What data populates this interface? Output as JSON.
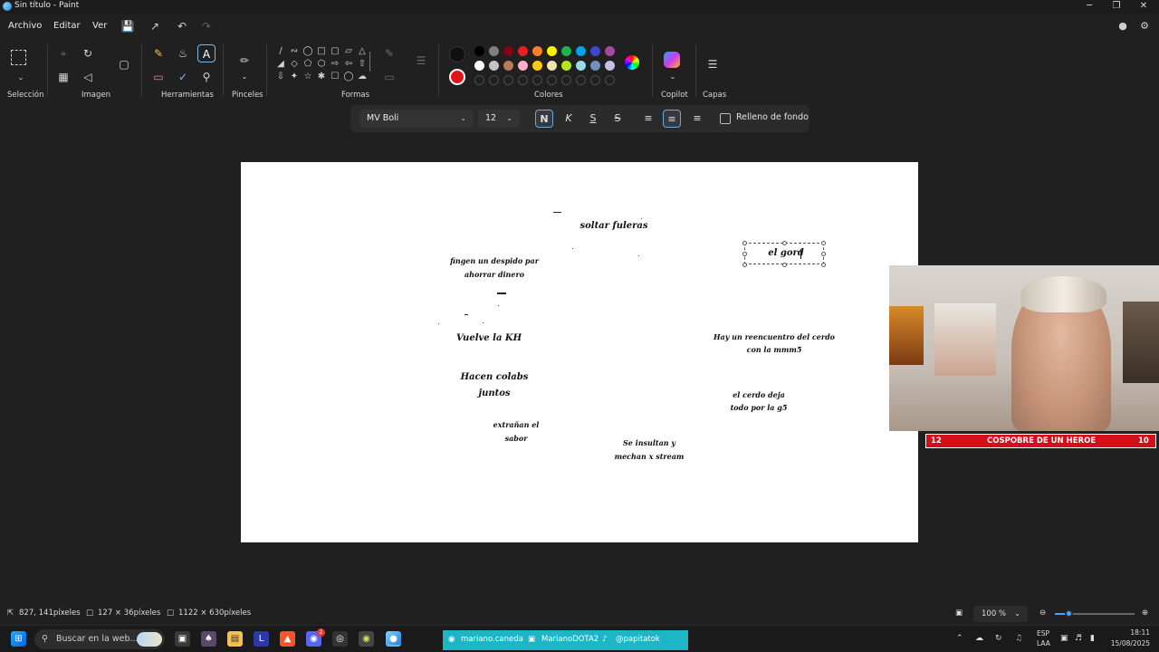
{
  "window": {
    "title": "Sin título - Paint",
    "minimize": "─",
    "maximize": "❐",
    "close": "✕"
  },
  "menu": {
    "items": [
      "Archivo",
      "Editar",
      "Ver"
    ]
  },
  "ribbon": {
    "groups": {
      "seleccion": "Selección",
      "imagen": "Imagen",
      "herramientas": "Herramientas",
      "pinceles": "Pinceles",
      "formas": "Formas",
      "colores": "Colores",
      "copilot": "Copilot",
      "capas": "Capas"
    },
    "colors": {
      "primary": "#111111",
      "secondary": "#e5121c",
      "row1": [
        "#000000",
        "#7f7f7f",
        "#880015",
        "#ed1c24",
        "#ff7f27",
        "#fff200",
        "#22b14c",
        "#00a2e8",
        "#3f48cc",
        "#a349a4"
      ],
      "row2": [
        "#ffffff",
        "#c3c3c3",
        "#b97a57",
        "#ffaec9",
        "#ffc90e",
        "#efe4b0",
        "#b5e61d",
        "#99d9ea",
        "#7092be",
        "#c8bfe7"
      ]
    }
  },
  "text_toolbar": {
    "font": "MV Boli",
    "size": "12",
    "bold": "N",
    "italic": "K",
    "underline": "S",
    "strikethrough": "S",
    "fill_label": "Relleno de fondo"
  },
  "canvas": {
    "texts": {
      "soltar": "soltar fuleras",
      "fingen1": "fingen un despido par",
      "fingen2": "ahorrar dinero",
      "vuelve": "Vuelve la KH",
      "hacen1": "Hacen colabs",
      "hacen2": "juntos",
      "extranan1": "extrañan el",
      "extranan2": "sabor",
      "insultan1": "Se insultan y",
      "insultan2": "mechan x stream",
      "reencuentro1": "Hay un reencuentro del cerdo",
      "reencuentro2": "con la mmm5",
      "cerdo1": "el cerdo deja",
      "cerdo2": "todo por la g5",
      "editing": "el gord"
    }
  },
  "webcam": {
    "left": "12",
    "title": "COSPOBRE DE UN HEROE",
    "right": "10"
  },
  "status": {
    "cursor": "827, 141píxeles",
    "selection": "127 × 36píxeles",
    "canvas_size": "1122 × 630píxeles",
    "zoom": "100 %",
    "zoom_fraction": 0.18
  },
  "taskbar": {
    "search_placeholder": "Buscar en la web...",
    "social": [
      "mariano.caneda",
      "MarianoDOTA2",
      "@papitatok"
    ],
    "lang1": "ESP",
    "lang2": "LAA",
    "time": "18:11",
    "date": "15/08/2025",
    "discord_badge": "2"
  }
}
